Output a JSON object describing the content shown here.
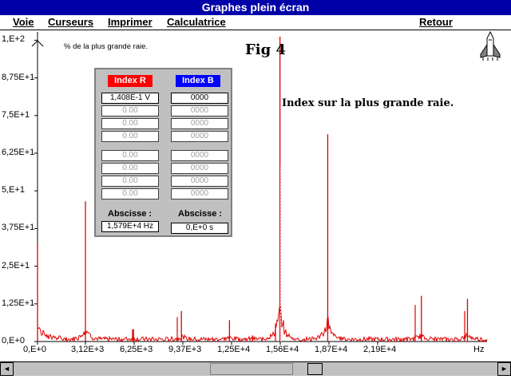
{
  "window": {
    "title": "Graphes plein écran"
  },
  "menu": {
    "voie": "Voie",
    "curseurs": "Curseurs",
    "imprimer": "Imprimer",
    "calculatrice": "Calculatrice",
    "retour": "Retour"
  },
  "figure": {
    "title": "Fig 4",
    "annotation": "Index sur la plus grande raie.",
    "ylabel": "% de la plus grande raie."
  },
  "panel": {
    "index_r_label": "Index R",
    "index_b_label": "Index B",
    "r_values": [
      "1,408E-1 V",
      "0.00",
      "0.00",
      "0.00",
      "0.00",
      "0.00",
      "0.00",
      "0.00"
    ],
    "b_values": [
      "0000",
      "0000",
      "0000",
      "0000",
      "0000",
      "0000",
      "0000",
      "0000"
    ],
    "abscisse_label": "Abscisse :",
    "abscisse_r": "1,579E+4 Hz",
    "abscisse_b": "0,E+0 s",
    "index_r_color": "#ff0000",
    "index_b_color": "#0000ff"
  },
  "chart_data": {
    "type": "line",
    "x_unit": "Hz",
    "x_ticks": [
      "0,E+0",
      "3,12E+3",
      "6,25E+3",
      "9,37E+3",
      "1,25E+4",
      "1,56E+4",
      "1,87E+4",
      "2,19E+4",
      "Hz"
    ],
    "y_ticks": [
      "0,E+0",
      "1,25E+1",
      "2,5E+1",
      "3,75E+1",
      "5,E+1",
      "6,25E+1",
      "7,5E+1",
      "8,75E+1",
      "1,E+2"
    ],
    "ylim": [
      0,
      100
    ],
    "xlim": [
      0,
      23500
    ],
    "series_color": "#e00000",
    "peaks": [
      {
        "x": 0,
        "y": 32
      },
      {
        "x": 3120,
        "y": 46
      },
      {
        "x": 6250,
        "y": 4
      },
      {
        "x": 9370,
        "y": 10
      },
      {
        "x": 12500,
        "y": 7
      },
      {
        "x": 14000,
        "y": 2
      },
      {
        "x": 15790,
        "y": 100
      },
      {
        "x": 18900,
        "y": 68
      },
      {
        "x": 25000,
        "y": 15
      },
      {
        "x": 28000,
        "y": 14
      }
    ]
  },
  "scrollbar": {
    "left_arrow": "◄",
    "right_arrow": "►"
  }
}
